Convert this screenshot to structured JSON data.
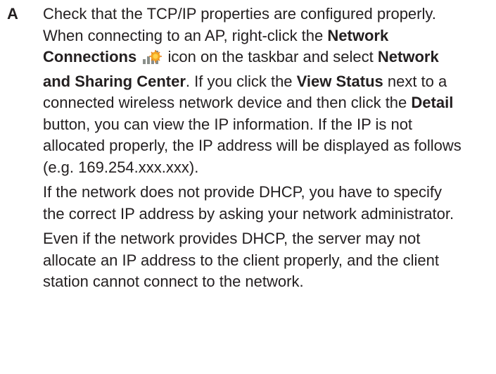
{
  "answer": {
    "label": "A",
    "p1": {
      "t1": "Check that the TCP/IP properties are configured properly. When connecting to an AP, right-click the ",
      "b1": "Network Connections",
      "icon": "network-connections-icon",
      "t2": " icon on the taskbar and select ",
      "b2": "Network and Sharing Center",
      "t3": ". If you click the ",
      "b3": "View Status",
      "t4": " next to a connected wireless network device and then click the ",
      "b4": "Detail",
      "t5": " button, you can view the IP information. If the IP is not allocated properly, the IP address will be displayed as follows (e.g. 169.254.xxx.xxx)."
    },
    "p2": "If the network does not provide DHCP, you have to specify the correct IP address by asking your network administrator.",
    "p3": "Even if the network provides DHCP, the server may not allocate an IP address to the client properly, and the client station cannot connect to the network."
  },
  "colors": {
    "text": "#231f20",
    "icon_orange": "#f5a623",
    "icon_gray": "#8a8f8a"
  }
}
